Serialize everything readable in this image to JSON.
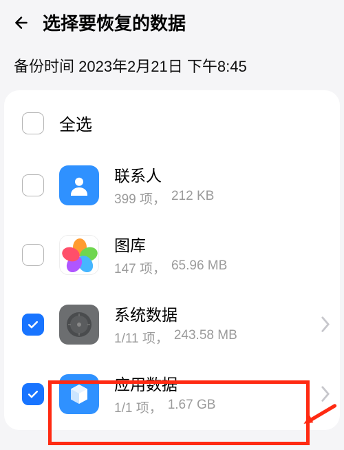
{
  "header": {
    "title": "选择要恢复的数据"
  },
  "backup_time": "备份时间 2023年2月21日 下午8:45",
  "select_all": {
    "label": "全选",
    "checked": false
  },
  "items": [
    {
      "title": "联系人",
      "count": "399 项，",
      "size": "212 KB",
      "checked": false,
      "has_chevron": false
    },
    {
      "title": "图库",
      "count": "147 项，",
      "size": "65.96 MB",
      "checked": false,
      "has_chevron": false
    },
    {
      "title": "系统数据",
      "count": "1/11 项，",
      "size": "243.58 MB",
      "checked": true,
      "has_chevron": true
    },
    {
      "title": "应用数据",
      "count": "1/1 项，",
      "size": "1.67 GB",
      "checked": true,
      "has_chevron": true
    }
  ]
}
